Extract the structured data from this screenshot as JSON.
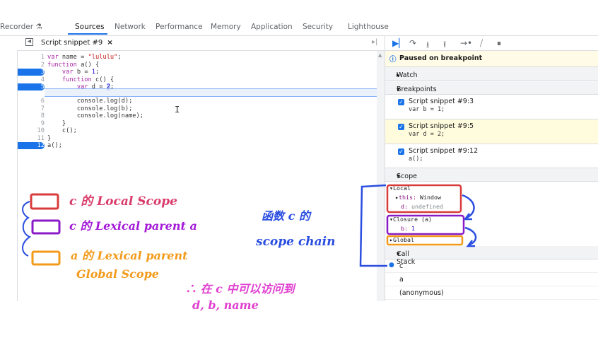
{
  "tabs": [
    "Recorder",
    "Sources",
    "Network",
    "Performance",
    "Memory",
    "Application",
    "Security",
    "Lighthouse"
  ],
  "active_tab": "Sources",
  "file_tab": {
    "name": "Script snippet #9",
    "close": "×"
  },
  "code_lines": [
    {
      "n": "1",
      "text": "var name = \"lululu\";"
    },
    {
      "n": "2",
      "text": "function a() {"
    },
    {
      "n": "3",
      "text": "    var b = 1;"
    },
    {
      "n": "4",
      "text": "    function c() {"
    },
    {
      "n": "5",
      "text": "        var d = 2;"
    },
    {
      "n": "6",
      "text": "        console.log(d);"
    },
    {
      "n": "7",
      "text": "        console.log(b);"
    },
    {
      "n": "8",
      "text": "        console.log(name);"
    },
    {
      "n": "9",
      "text": "    }"
    },
    {
      "n": "10",
      "text": "    c();"
    },
    {
      "n": "11",
      "text": "}"
    },
    {
      "n": "12",
      "text": "a();"
    }
  ],
  "breakpoint_lines": [
    "3",
    "5",
    "12"
  ],
  "current_line": "5",
  "debugger": {
    "paused": "Paused on breakpoint",
    "sections": {
      "watch": "Watch",
      "breakpoints": "Breakpoints",
      "scope": "Scope",
      "callstack": "Call Stack"
    },
    "breakpoints": [
      {
        "label": "Script snippet #9:3",
        "code": "var b = 1;"
      },
      {
        "label": "Script snippet #9:5",
        "code": "var d = 2;"
      },
      {
        "label": "Script snippet #9:12",
        "code": "a();"
      }
    ],
    "scope": {
      "local": "Local",
      "this_key": "this:",
      "this_val": "Window",
      "d_key": "d:",
      "d_val": "undefined",
      "closure": "Closure (a)",
      "b_key": "b:",
      "b_val": "1",
      "global": "Global"
    },
    "callstack": [
      "c",
      "a",
      "(anonymous)"
    ]
  },
  "annotations": {
    "local": "c 的 Local Scope",
    "lexical_a": "c 的 Lexical parent a",
    "lexical_global_1": "a 的 Lexical parent",
    "lexical_global_2": "Global Scope",
    "chain_1": "函数 c 的",
    "chain_2": "scope chain",
    "conclusion_1": "∴ 在 c 中可以访问到",
    "conclusion_2": "d, b, name"
  },
  "colors": {
    "red": "#d93b3b",
    "purple": "#8a1ac8",
    "orange": "#f29a1a",
    "blue": "#2a4ee0",
    "magenta": "#e03fd0",
    "accent": "#1a73e8"
  }
}
